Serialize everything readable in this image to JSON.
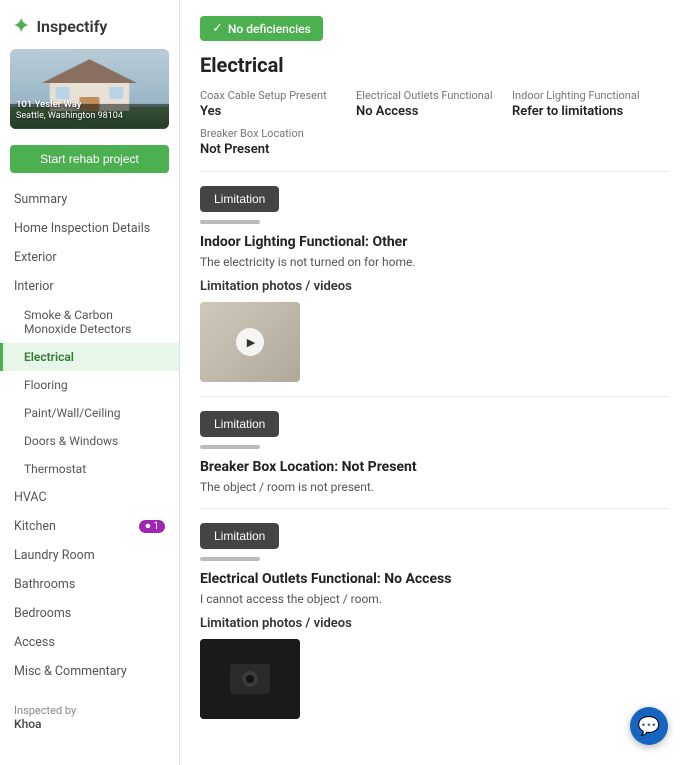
{
  "app": {
    "logo_text": "Inspectify",
    "logo_icon": "🐦"
  },
  "property": {
    "street": "101 Yesler Way",
    "city_state": "Seattle, Washington 98104",
    "rehab_button": "Start rehab project"
  },
  "sidebar": {
    "nav": [
      {
        "id": "summary",
        "label": "Summary",
        "level": "top",
        "active": false
      },
      {
        "id": "home-inspection",
        "label": "Home Inspection Details",
        "level": "top",
        "active": false
      },
      {
        "id": "exterior",
        "label": "Exterior",
        "level": "top",
        "active": false
      },
      {
        "id": "interior",
        "label": "Interior",
        "level": "top",
        "active": false
      },
      {
        "id": "smoke",
        "label": "Smoke & Carbon Monoxide Detectors",
        "level": "sub",
        "active": false
      },
      {
        "id": "electrical",
        "label": "Electrical",
        "level": "sub",
        "active": true
      },
      {
        "id": "flooring",
        "label": "Flooring",
        "level": "sub",
        "active": false
      },
      {
        "id": "paint",
        "label": "Paint/Wall/Ceiling",
        "level": "sub",
        "active": false
      },
      {
        "id": "doors",
        "label": "Doors & Windows",
        "level": "sub",
        "active": false
      },
      {
        "id": "thermostat",
        "label": "Thermostat",
        "level": "sub",
        "active": false
      },
      {
        "id": "hvac",
        "label": "HVAC",
        "level": "top",
        "active": false
      },
      {
        "id": "kitchen",
        "label": "Kitchen",
        "level": "top",
        "active": false,
        "badge": "1"
      },
      {
        "id": "laundry",
        "label": "Laundry Room",
        "level": "top",
        "active": false
      },
      {
        "id": "bathrooms",
        "label": "Bathrooms",
        "level": "top",
        "active": false
      },
      {
        "id": "bedrooms",
        "label": "Bedrooms",
        "level": "top",
        "active": false
      },
      {
        "id": "access",
        "label": "Access",
        "level": "top",
        "active": false
      },
      {
        "id": "misc",
        "label": "Misc & Commentary",
        "level": "top",
        "active": false
      }
    ],
    "footer": {
      "inspected_by_label": "Inspected by",
      "inspector_name": "Khoa"
    }
  },
  "main": {
    "badge": "No deficiencies",
    "section_title": "Electrical",
    "info_items": [
      {
        "label": "Coax Cable Setup Present",
        "value": "Yes"
      },
      {
        "label": "Electrical Outlets Functional",
        "value": "No Access"
      },
      {
        "label": "Indoor Lighting Functional",
        "value": "Refer to limitations"
      }
    ],
    "info_row2": [
      {
        "label": "Breaker Box Location",
        "value": "Not Present"
      }
    ],
    "limitations": [
      {
        "id": "limitation-1",
        "button_label": "Limitation",
        "title": "Indoor Lighting Functional: Other",
        "description": "The electricity is not turned on for home.",
        "photos_label": "Limitation photos / videos",
        "has_video": true,
        "has_photo": false
      },
      {
        "id": "limitation-2",
        "button_label": "Limitation",
        "title": "Breaker Box Location: Not Present",
        "description": "The object / room is not present.",
        "photos_label": "",
        "has_video": false,
        "has_photo": false
      },
      {
        "id": "limitation-3",
        "button_label": "Limitation",
        "title": "Electrical Outlets Functional: No Access",
        "description": "I cannot access the object / room.",
        "photos_label": "Limitation photos / videos",
        "has_video": false,
        "has_photo": true
      }
    ]
  }
}
